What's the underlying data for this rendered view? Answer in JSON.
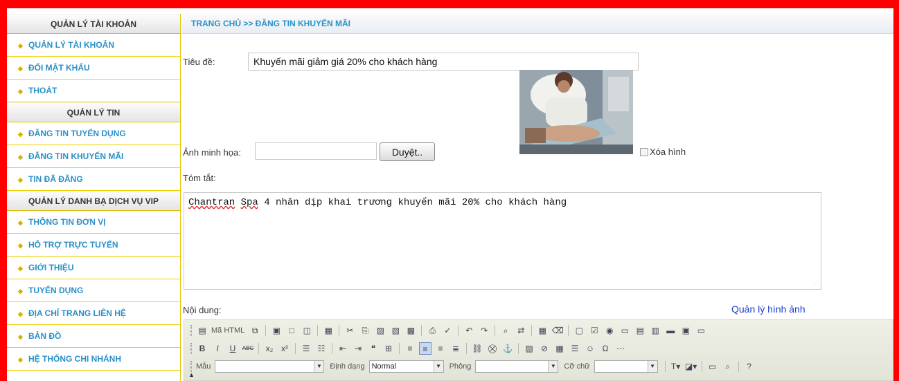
{
  "sidebar": {
    "section1": "QUẢN LÝ TÀI KHOẢN",
    "group1": [
      "QUẢN LÝ TÀI KHOẢN",
      "ĐỔI MẬT KHẨU",
      "THOÁT"
    ],
    "section2": "QUẢN LÝ TIN",
    "group2": [
      "ĐĂNG TIN TUYỂN DỤNG",
      "ĐĂNG TIN KHUYẾN MÃI",
      "TIN ĐÃ ĐĂNG"
    ],
    "section3": "QUẢN LÝ DANH BẠ DỊCH VỤ VIP",
    "group3": [
      "THÔNG TIN ĐƠN VỊ",
      "HỖ TRỢ TRỰC TUYẾN",
      "GIỚI THIỆU",
      "TUYỂN DỤNG",
      "ĐỊA CHỈ TRANG LIÊN HỆ",
      "BẢN ĐỒ",
      "HỆ THỐNG CHI NHÁNH"
    ]
  },
  "breadcrumb": "TRANG CHỦ  >> ĐĂNG TIN KHUYẾN MÃI",
  "form": {
    "title_label": "Tiêu đề:",
    "title_value": "Khuyến mãi giảm giá 20% cho khách hàng",
    "image_label": "Ảnh minh họa:",
    "browse_button": "Duyệt..",
    "delete_image_label": "Xóa hình",
    "summary_label": "Tóm tắt:",
    "summary_value_word1": "Chantran",
    "summary_value_word2": "Spa",
    "summary_value_rest": "4 nhân dịp khai trương khuyến mãi 20% cho khách hàng",
    "content_label": "Nội dung:",
    "image_manager_link": "Quản lý hình ảnh"
  },
  "editor": {
    "source_label": "Mã HTML",
    "style_label": "Mẫu",
    "format_label": "Định dạng",
    "format_value": "Normal",
    "font_label": "Phông",
    "size_label": "Cỡ chữ"
  }
}
